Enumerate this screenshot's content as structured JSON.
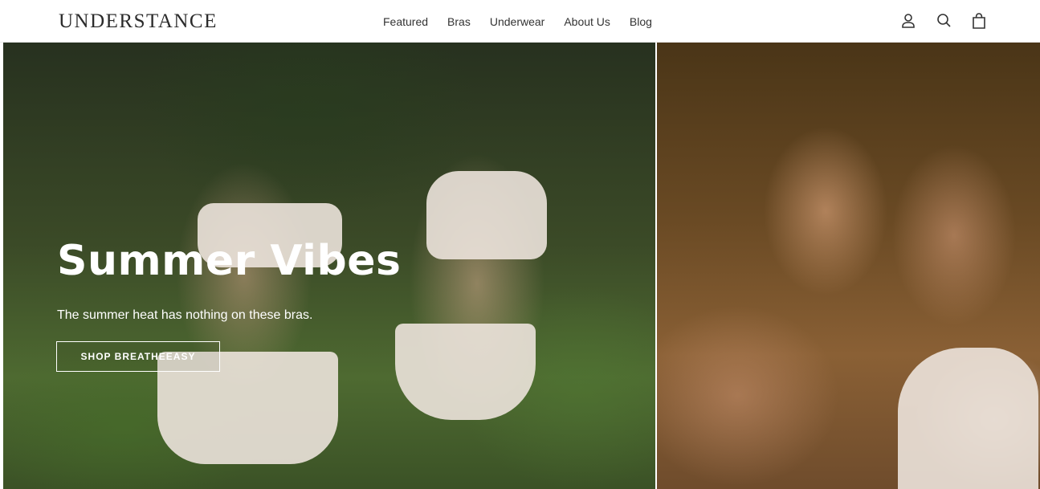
{
  "header": {
    "logo": "UNDERSTANCE",
    "nav": [
      "Featured",
      "Bras",
      "Underwear",
      "About Us",
      "Blog"
    ],
    "icons": [
      "account-icon",
      "search-icon",
      "cart-icon"
    ]
  },
  "hero": {
    "headline": "Summer Vibes",
    "subline": "The summer heat has nothing on these bras.",
    "cta_label": "SHOP BREATHEEASY"
  },
  "colors": {
    "text": "#333333",
    "overlay_text": "#ffffff"
  }
}
